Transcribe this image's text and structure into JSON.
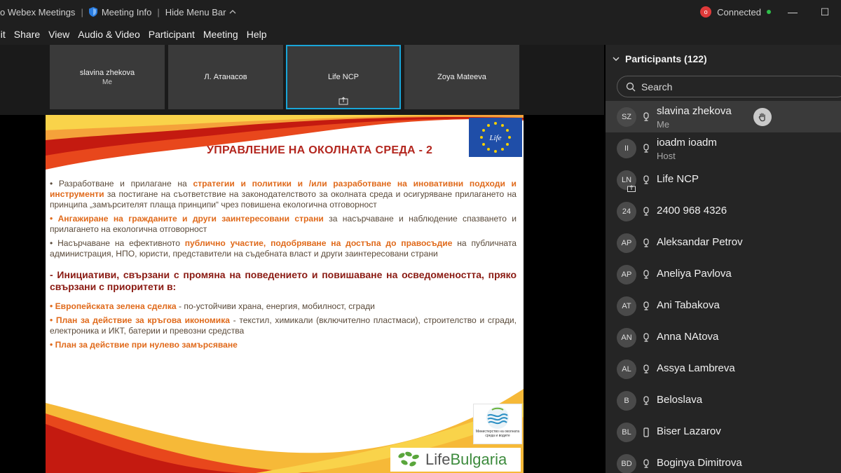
{
  "titlebar": {
    "app_title": "o Webex Meetings",
    "meeting_info": "Meeting Info",
    "hide_menu": "Hide Menu Bar",
    "connected": "Connected",
    "minimize": "—",
    "restore": "☐"
  },
  "menu": {
    "items": [
      "dit",
      "Share",
      "View",
      "Audio & Video",
      "Participant",
      "Meeting",
      "Help"
    ]
  },
  "thumbnails": [
    {
      "name": "slavina zhekova",
      "sub": "Me"
    },
    {
      "name": "Л. Атанасов",
      "sub": ""
    },
    {
      "name": "Life NCP",
      "sub": ""
    },
    {
      "name": "Zoya Mateeva",
      "sub": ""
    }
  ],
  "slide": {
    "title": "УПРАВЛЕНИЕ НА ОКОЛНАТА СРЕДА - 2",
    "b1_pre": "• Разработване и прилагане на ",
    "b1_hl1": "стратегии и политики и /или разработване на иновативни подходи и инструменти",
    "b1_post": " за постигане на съответствие на законодателството за околната среда и осигуряване прилагането на принципа „замърсителят плаща принципи“ чрез повишена екологична отговорност",
    "b2_hl": "• Ангажиране на гражданите и други заинтересовани страни",
    "b2_post": " за насърчаване и наблюдение спазването и прилагането на екологична отговорност",
    "b3_pre": "• Насърчаване на ефективното ",
    "b3_hl": "публично участие, подобряване на достъпа до правосъдие",
    "b3_post": " на публичната администрация, НПО, юристи, представители на съдебната власт и други заинтересовани страни",
    "initiatives": "- Инициативи, свързани с промяна на поведението и повишаване на осведомеността, пряко свързани с приоритети в:",
    "i1_hl": "• Европейската зелена сделка",
    "i1_post": " - по-устойчиви храна, енергия, мобилност, сгради",
    "i2_hl": "• План за действие за кръгова икономика",
    "i2_post": " - текстил, химикали (включително пластмаси), строителство и сгради, електроника и ИКТ, батерии и превозни средства",
    "i3_hl": "• План за действие при нулево замърсяване",
    "eu_logo": "Life",
    "ministry": "Министерство на околната среда и водите",
    "lifebg_life": "Life",
    "lifebg_bulgaria": "Bulgaria"
  },
  "participants": {
    "header": "Participants (122)",
    "search_placeholder": "Search",
    "list": [
      {
        "initials": "SZ",
        "name": "slavina zhekova",
        "role": "Me"
      },
      {
        "initials": "II",
        "name": "ioadm ioadm",
        "role": "Host"
      },
      {
        "initials": "LN",
        "name": "Life NCP",
        "role": ""
      },
      {
        "initials": "24",
        "name": "2400 968 4326",
        "role": ""
      },
      {
        "initials": "AP",
        "name": "Aleksandar Petrov",
        "role": ""
      },
      {
        "initials": "AP",
        "name": "Aneliya Pavlova",
        "role": ""
      },
      {
        "initials": "AT",
        "name": "Ani Tabakova",
        "role": ""
      },
      {
        "initials": "AN",
        "name": "Anna NAtova",
        "role": ""
      },
      {
        "initials": "AL",
        "name": "Assya Lambreva",
        "role": ""
      },
      {
        "initials": "B",
        "name": "Beloslava",
        "role": ""
      },
      {
        "initials": "BL",
        "name": "Biser Lazarov",
        "role": ""
      },
      {
        "initials": "BD",
        "name": "Boginya Dimitrova",
        "role": ""
      }
    ]
  },
  "colors": {
    "accent": "#19a6d9",
    "slide_title": "#b3261e",
    "highlight_orange": "#e06a1b",
    "connected_dot": "#2fbf4a"
  }
}
